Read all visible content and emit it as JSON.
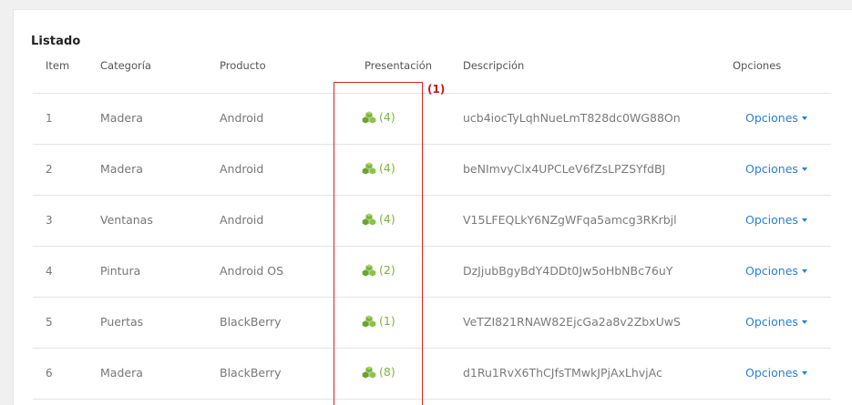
{
  "panel": {
    "title": "Listado"
  },
  "table": {
    "headers": {
      "item": "Item",
      "categoria": "Categoría",
      "producto": "Producto",
      "presentacion": "Presentación",
      "descripcion": "Descripción",
      "opciones": "Opciones"
    },
    "rows": [
      {
        "item": "1",
        "categoria": "Madera",
        "producto": "Android",
        "presentacion": "(4)",
        "descripcion": "ucb4iocTyLqhNueLmT828dc0WG88On",
        "opciones": "Opciones"
      },
      {
        "item": "2",
        "categoria": "Madera",
        "producto": "Android",
        "presentacion": "(4)",
        "descripcion": "beNImvyClx4UPCLeV6fZsLPZSYfdBJ",
        "opciones": "Opciones"
      },
      {
        "item": "3",
        "categoria": "Ventanas",
        "producto": "Android",
        "presentacion": "(4)",
        "descripcion": "V15LFEQLkY6NZgWFqa5amcg3RKrbjl",
        "opciones": "Opciones"
      },
      {
        "item": "4",
        "categoria": "Pintura",
        "producto": "Android OS",
        "presentacion": "(2)",
        "descripcion": "DzJjubBgyBdY4DDt0Jw5oHbNBc76uY",
        "opciones": "Opciones"
      },
      {
        "item": "5",
        "categoria": "Puertas",
        "producto": "BlackBerry",
        "presentacion": "(1)",
        "descripcion": "VeTZI821RNAW82EjcGa2a8v2ZbxUwS",
        "opciones": "Opciones"
      },
      {
        "item": "6",
        "categoria": "Madera",
        "producto": "BlackBerry",
        "presentacion": "(8)",
        "descripcion": "d1Ru1RvX6ThCJfsTMwkJPjAxLhvjAc",
        "opciones": "Opciones"
      }
    ]
  },
  "annotation": {
    "label": "(1)",
    "color": "#e0201a"
  },
  "colors": {
    "presentation_green": "#7bb33b",
    "link_blue": "#2a7fd6"
  },
  "icons": {
    "presentation": "cubes-icon",
    "options_caret": "caret-down-icon"
  }
}
